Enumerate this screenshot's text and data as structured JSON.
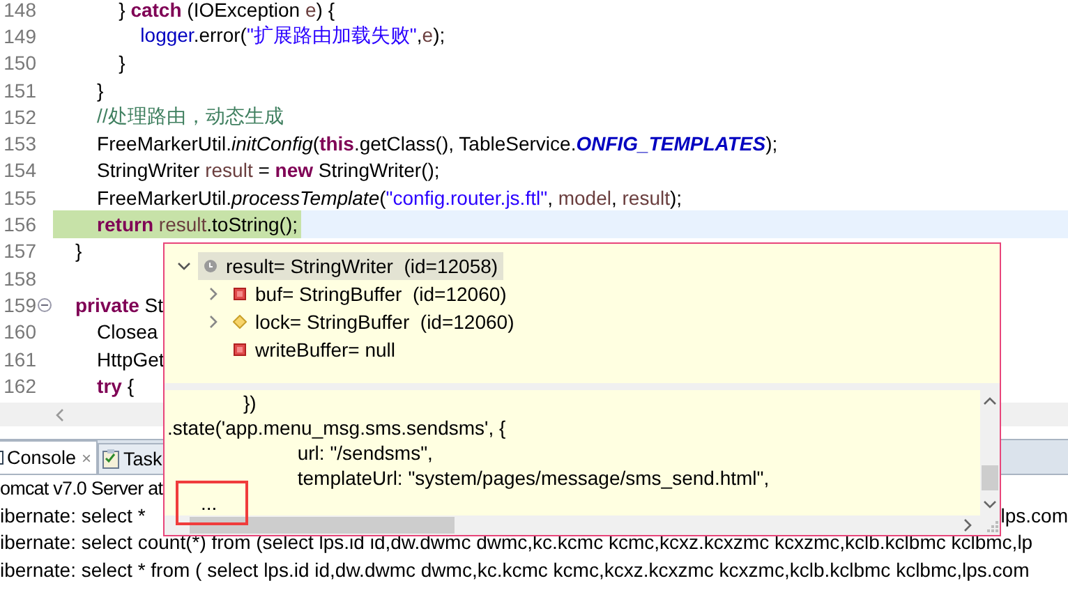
{
  "editor": {
    "lines": [
      {
        "number": "148",
        "current": false,
        "foldable": false,
        "code": [
          {
            "kind": "plain",
            "text": "        } "
          },
          {
            "kind": "keyword",
            "text": "catch"
          },
          {
            "kind": "plain",
            "text": " (IOException "
          },
          {
            "kind": "local",
            "text": "e"
          },
          {
            "kind": "plain",
            "text": ") {"
          }
        ]
      },
      {
        "number": "149",
        "current": false,
        "foldable": false,
        "code": [
          {
            "kind": "field",
            "text": "            logger"
          },
          {
            "kind": "plain",
            "text": ".error("
          },
          {
            "kind": "string",
            "text": "\"扩展路由加载失败\""
          },
          {
            "kind": "plain",
            "text": ","
          },
          {
            "kind": "local",
            "text": "e"
          },
          {
            "kind": "plain",
            "text": ");"
          }
        ]
      },
      {
        "number": "150",
        "current": false,
        "foldable": false,
        "code": [
          {
            "kind": "plain",
            "text": "        }"
          }
        ]
      },
      {
        "number": "151",
        "current": false,
        "foldable": false,
        "code": [
          {
            "kind": "plain",
            "text": "    }"
          }
        ]
      },
      {
        "number": "152",
        "current": false,
        "foldable": false,
        "code": [
          {
            "kind": "comment",
            "text": "    //处理路由，动态生成"
          }
        ]
      },
      {
        "number": "153",
        "current": false,
        "foldable": false,
        "code": [
          {
            "kind": "plain",
            "text": "    FreeMarkerUtil."
          },
          {
            "kind": "static",
            "text": "initConfig"
          },
          {
            "kind": "plain",
            "text": "("
          },
          {
            "kind": "keyword",
            "text": "this"
          },
          {
            "kind": "plain",
            "text": ".getClass(), TableService."
          },
          {
            "kind": "constant",
            "text": "ONFIG_TEMPLATES"
          },
          {
            "kind": "plain",
            "text": ");"
          }
        ]
      },
      {
        "number": "154",
        "current": false,
        "foldable": false,
        "code": [
          {
            "kind": "plain",
            "text": "    StringWriter "
          },
          {
            "kind": "local",
            "text": "result"
          },
          {
            "kind": "plain",
            "text": " = "
          },
          {
            "kind": "keyword",
            "text": "new"
          },
          {
            "kind": "plain",
            "text": " StringWriter();"
          }
        ]
      },
      {
        "number": "155",
        "current": false,
        "foldable": false,
        "code": [
          {
            "kind": "plain",
            "text": "    FreeMarkerUtil."
          },
          {
            "kind": "static",
            "text": "processTemplate"
          },
          {
            "kind": "plain",
            "text": "("
          },
          {
            "kind": "string",
            "text": "\"config.router.js.ftl\""
          },
          {
            "kind": "plain",
            "text": ", "
          },
          {
            "kind": "local",
            "text": "model"
          },
          {
            "kind": "plain",
            "text": ", "
          },
          {
            "kind": "local",
            "text": "result"
          },
          {
            "kind": "plain",
            "text": ");"
          }
        ]
      },
      {
        "number": "156",
        "current": true,
        "foldable": false,
        "code": [
          {
            "kind": "keyword",
            "text": "    return"
          },
          {
            "kind": "local",
            "text": " result"
          },
          {
            "kind": "plain",
            "text": ".toString();"
          }
        ]
      },
      {
        "number": "157",
        "current": false,
        "foldable": false,
        "code": [
          {
            "kind": "plain",
            "text": "}"
          }
        ]
      },
      {
        "number": "158",
        "current": false,
        "foldable": false
      },
      {
        "number": "159",
        "current": false,
        "foldable": true,
        "code": [
          {
            "kind": "keyword",
            "text": "private"
          },
          {
            "kind": "plain",
            "text": " St"
          }
        ]
      },
      {
        "number": "160",
        "current": false,
        "foldable": false,
        "code": [
          {
            "kind": "plain",
            "text": "    Closea"
          }
        ]
      },
      {
        "number": "161",
        "current": false,
        "foldable": false,
        "code": [
          {
            "kind": "plain",
            "text": "    HttpGet"
          }
        ]
      },
      {
        "number": "162",
        "current": false,
        "foldable": false,
        "code": [
          {
            "kind": "keyword",
            "text": "    try"
          },
          {
            "kind": "plain",
            "text": " {"
          }
        ]
      }
    ]
  },
  "console": {
    "tabs": [
      {
        "label": "Console",
        "close": "×",
        "selected": true,
        "kind": "console"
      },
      {
        "label": "Task",
        "selected": false,
        "kind": "tasks"
      }
    ],
    "server": "omcat v7.0 Server at",
    "lines": [
      {
        "left": "ibernate: select *",
        "right": "lps.com"
      },
      {
        "left": "ibernate: select count(*) from (select lps.id id,dw.dwmc dwmc,kc.kcmc kcmc,kcxz.kcxzmc kcxzmc,kclb.kclbmc kclbmc,lp"
      },
      {
        "left": "ibernate: select * from ( select lps.id id,dw.dwmc dwmc,kc.kcmc kcmc,kcxz.kcxzmc kcxzmc,kclb.kclbmc kclbmc,lps.com"
      }
    ]
  },
  "hover": {
    "tree": [
      {
        "label": "result= StringWriter  (id=12058)",
        "kind": "local",
        "has_children": true,
        "expanded": true,
        "selected": true,
        "children": [
          {
            "label": "buf= StringBuffer  (id=12060)",
            "kind": "private",
            "has_children": true,
            "expanded": false,
            "selected": false
          },
          {
            "label": "lock= StringBuffer  (id=12060)",
            "kind": "protected",
            "has_children": true,
            "expanded": false,
            "selected": false
          },
          {
            "label": "writeBuffer= null",
            "kind": "private",
            "has_children": false,
            "selected": false
          }
        ]
      }
    ],
    "detail": [
      {
        "text": "              })",
        "marked": false
      },
      {
        "text": ".state('app.menu_msg.sms.sendsms', {",
        "marked": false
      },
      {
        "text": "                        url: \"/sendsms\",",
        "marked": false
      },
      {
        "text": "                        templateUrl: \"system/pages/message/sms_send.html\",",
        "marked": false
      },
      {
        "text": "...",
        "marked": true
      }
    ]
  }
}
